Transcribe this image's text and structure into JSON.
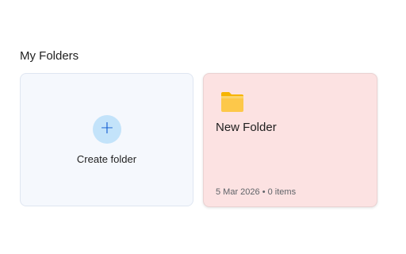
{
  "section": {
    "title": "My Folders"
  },
  "create_card": {
    "icon": "plus-icon",
    "icon_glyph": "+",
    "label": "Create folder"
  },
  "folders": [
    {
      "icon": "folder-icon",
      "name": "New Folder",
      "meta": "5 Mar 2026 • 0 items",
      "background": "#fce2e2"
    }
  ],
  "colors": {
    "accent": "#0b57d0",
    "plus_circle": "#c3e3fa",
    "folder_yellow": "#fbc02d"
  }
}
